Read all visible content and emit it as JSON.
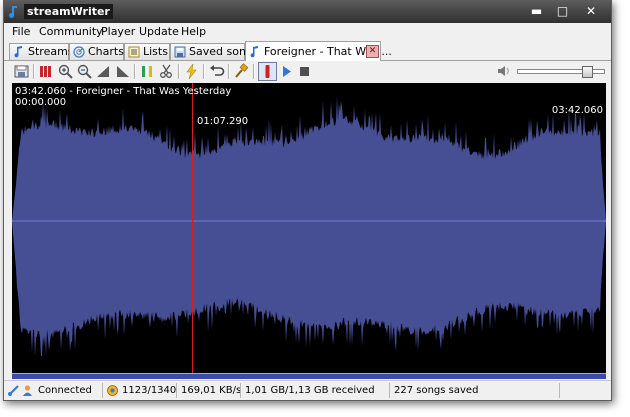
{
  "window": {
    "title": "streamWriter"
  },
  "menu": [
    "File",
    "Community",
    "Player",
    "Update",
    "Help"
  ],
  "tabs": [
    {
      "label": "Streams",
      "icon": "music-note-icon"
    },
    {
      "label": "Charts",
      "icon": "radar-icon"
    },
    {
      "label": "Lists",
      "icon": "list-icon"
    },
    {
      "label": "Saved songs",
      "icon": "saved-songs-icon"
    },
    {
      "label": "Foreigner - That Was ...",
      "icon": "music-note-icon",
      "active": true
    }
  ],
  "toolbar": {
    "buttons": [
      "save-icon",
      "cut-icon",
      "zoom-in-icon",
      "zoom-out-icon",
      "fade-in-icon",
      "fade-out-icon",
      "mark-icon",
      "scissors-icon",
      "auto-cut-icon",
      "undo-icon",
      "apply-icon",
      "record-icon",
      "play-icon",
      "stop-icon"
    ],
    "volume": 0.85
  },
  "waveform": {
    "track_label": "03:42.060 - Foreigner - That Was Yesterday",
    "start_time": "00:00.000",
    "cursor_time": "01:07.290",
    "end_time": "03:42.060",
    "cursor_fraction": 0.303,
    "wave_color": "#464f94",
    "cursor_color": "#d81f1f",
    "center_line_color": "#6f7cd6"
  },
  "status": {
    "connection": "Connected",
    "counts": "1123/1340",
    "speed": "169,01 KB/s",
    "received": "1,01 GB/1,13 GB received",
    "saved": "227 songs saved"
  }
}
